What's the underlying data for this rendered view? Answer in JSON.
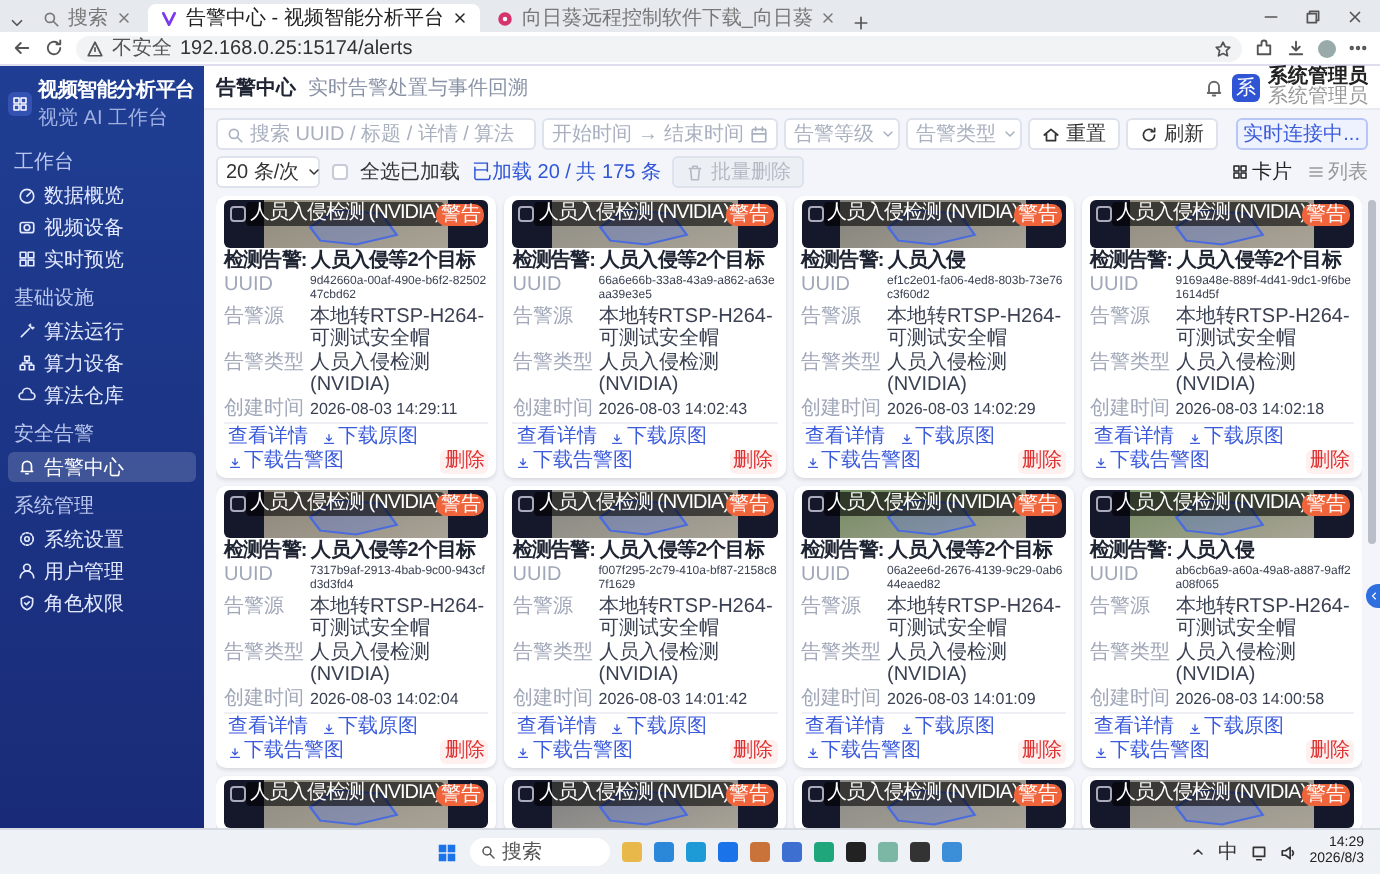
{
  "browser": {
    "tabs": [
      {
        "title": "搜索",
        "selected": false
      },
      {
        "title": "告警中心 - 视频智能分析平台",
        "selected": true
      },
      {
        "title": "向日葵远程控制软件下载_向日葵",
        "selected": false
      }
    ],
    "security": "不安全",
    "url": "192.168.0.25:15174/alerts"
  },
  "sidebar": {
    "brand": {
      "title": "视频智能分析平台",
      "subtitle": "视觉 AI 工作台"
    },
    "sections": [
      {
        "title": "工作台",
        "items": [
          {
            "label": "数据概览",
            "selected": false
          },
          {
            "label": "视频设备",
            "selected": false
          },
          {
            "label": "实时预览",
            "selected": false
          }
        ]
      },
      {
        "title": "基础设施",
        "items": [
          {
            "label": "算法运行",
            "selected": false
          },
          {
            "label": "算力设备",
            "selected": false
          },
          {
            "label": "算法仓库",
            "selected": false
          }
        ]
      },
      {
        "title": "安全告警",
        "items": [
          {
            "label": "告警中心",
            "selected": true
          }
        ]
      },
      {
        "title": "系统管理",
        "items": [
          {
            "label": "系统设置",
            "selected": false
          },
          {
            "label": "用户管理",
            "selected": false
          },
          {
            "label": "角色权限",
            "selected": false
          }
        ]
      }
    ]
  },
  "header": {
    "title": "告警中心",
    "subtitle": "实时告警处置与事件回溯",
    "user": {
      "avatar": "系",
      "name": "系统管理员",
      "role": "系统管理员"
    }
  },
  "filters": {
    "search": {
      "placeholder": "搜索 UUID / 标题 / 详情 / 算法"
    },
    "start": {
      "placeholder": "开始时间"
    },
    "arrow": "→",
    "end": {
      "placeholder": "结束时间"
    },
    "level": {
      "placeholder": "告警等级"
    },
    "type": {
      "placeholder": "告警类型"
    },
    "reset": "重置",
    "refresh": "刷新",
    "connection": "实时连接中..."
  },
  "toolbar": {
    "page_size": "20 条/次",
    "select_all": {
      "label": "全选已加载",
      "checked": false
    },
    "loaded": "已加载 20 / 共 175 条",
    "bulk_delete": {
      "label": "批量删除",
      "disabled": true
    },
    "views": [
      {
        "label": "卡片",
        "selected": true
      },
      {
        "label": "列表",
        "selected": false
      }
    ]
  },
  "alerts": [
    {
      "overlay": "人员入侵检测 (NVIDIA)",
      "badge": "警告",
      "checked": false,
      "title": "检测告警: 人员入侵等2个目标",
      "fields": [
        {
          "label": "UUID",
          "value": "9d42660a-00af-490e-b6f2-8250247cbd62",
          "kind": "id"
        },
        {
          "label": "告警源",
          "value": "本地转RTSP-H264-可测试安全帽",
          "kind": "text"
        },
        {
          "label": "告警类型",
          "value": "人员入侵检测 (NVIDIA)",
          "kind": "text"
        },
        {
          "label": "创建时间",
          "value": "2026-08-03 14:29:11",
          "kind": "time"
        }
      ],
      "actions": [
        {
          "label": "查看详情",
          "kind": "view"
        },
        {
          "label": "下载原图",
          "kind": "download"
        },
        {
          "label": "下载告警图",
          "kind": "download"
        },
        {
          "label": "删除",
          "kind": "delete"
        }
      ]
    },
    {
      "overlay": "人员入侵检测 (NVIDIA)",
      "badge": "警告",
      "checked": false,
      "title": "检测告警: 人员入侵等2个目标",
      "fields": [
        {
          "label": "UUID",
          "value": "66a6e66b-33a8-43a9-a862-a63eaa39e3e5",
          "kind": "id"
        },
        {
          "label": "告警源",
          "value": "本地转RTSP-H264-可测试安全帽",
          "kind": "text"
        },
        {
          "label": "告警类型",
          "value": "人员入侵检测 (NVIDIA)",
          "kind": "text"
        },
        {
          "label": "创建时间",
          "value": "2026-08-03 14:02:43",
          "kind": "time"
        }
      ],
      "actions": [
        {
          "label": "查看详情",
          "kind": "view"
        },
        {
          "label": "下载原图",
          "kind": "download"
        },
        {
          "label": "下载告警图",
          "kind": "download"
        },
        {
          "label": "删除",
          "kind": "delete"
        }
      ]
    },
    {
      "overlay": "人员入侵检测 (NVIDIA)",
      "badge": "警告",
      "checked": false,
      "title": "检测告警: 人员入侵",
      "fields": [
        {
          "label": "UUID",
          "value": "ef1c2e01-fa06-4ed8-803b-73e76c3f60d2",
          "kind": "id"
        },
        {
          "label": "告警源",
          "value": "本地转RTSP-H264-可测试安全帽",
          "kind": "text"
        },
        {
          "label": "告警类型",
          "value": "人员入侵检测 (NVIDIA)",
          "kind": "text"
        },
        {
          "label": "创建时间",
          "value": "2026-08-03 14:02:29",
          "kind": "time"
        }
      ],
      "actions": [
        {
          "label": "查看详情",
          "kind": "view"
        },
        {
          "label": "下载原图",
          "kind": "download"
        },
        {
          "label": "下载告警图",
          "kind": "download"
        },
        {
          "label": "删除",
          "kind": "delete"
        }
      ]
    },
    {
      "overlay": "人员入侵检测 (NVIDIA)",
      "badge": "警告",
      "checked": false,
      "title": "检测告警: 人员入侵等2个目标",
      "fields": [
        {
          "label": "UUID",
          "value": "9169a48e-889f-4d41-9dc1-9f6be1614d5f",
          "kind": "id"
        },
        {
          "label": "告警源",
          "value": "本地转RTSP-H264-可测试安全帽",
          "kind": "text"
        },
        {
          "label": "告警类型",
          "value": "人员入侵检测 (NVIDIA)",
          "kind": "text"
        },
        {
          "label": "创建时间",
          "value": "2026-08-03 14:02:18",
          "kind": "time"
        }
      ],
      "actions": [
        {
          "label": "查看详情",
          "kind": "view"
        },
        {
          "label": "下载原图",
          "kind": "download"
        },
        {
          "label": "下载告警图",
          "kind": "download"
        },
        {
          "label": "删除",
          "kind": "delete"
        }
      ]
    },
    {
      "overlay": "人员入侵检测 (NVIDIA)",
      "badge": "警告",
      "checked": false,
      "title": "检测告警: 人员入侵等2个目标",
      "fields": [
        {
          "label": "UUID",
          "value": "7317b9af-2913-4bab-9c00-943cfd3d3fd4",
          "kind": "id"
        },
        {
          "label": "告警源",
          "value": "本地转RTSP-H264-可测试安全帽",
          "kind": "text"
        },
        {
          "label": "告警类型",
          "value": "人员入侵检测 (NVIDIA)",
          "kind": "text"
        },
        {
          "label": "创建时间",
          "value": "2026-08-03 14:02:04",
          "kind": "time"
        }
      ],
      "actions": [
        {
          "label": "查看详情",
          "kind": "view"
        },
        {
          "label": "下载原图",
          "kind": "download"
        },
        {
          "label": "下载告警图",
          "kind": "download"
        },
        {
          "label": "删除",
          "kind": "delete"
        }
      ]
    },
    {
      "overlay": "人员入侵检测 (NVIDIA)",
      "badge": "警告",
      "checked": false,
      "title": "检测告警: 人员入侵等2个目标",
      "fields": [
        {
          "label": "UUID",
          "value": "f007f295-2c79-410a-bf87-2158c87f1629",
          "kind": "id"
        },
        {
          "label": "告警源",
          "value": "本地转RTSP-H264-可测试安全帽",
          "kind": "text"
        },
        {
          "label": "告警类型",
          "value": "人员入侵检测 (NVIDIA)",
          "kind": "text"
        },
        {
          "label": "创建时间",
          "value": "2026-08-03 14:01:42",
          "kind": "time"
        }
      ],
      "actions": [
        {
          "label": "查看详情",
          "kind": "view"
        },
        {
          "label": "下载原图",
          "kind": "download"
        },
        {
          "label": "下载告警图",
          "kind": "download"
        },
        {
          "label": "删除",
          "kind": "delete"
        }
      ]
    },
    {
      "overlay": "人员入侵检测 (NVIDIA)",
      "badge": "警告",
      "checked": false,
      "title": "检测告警: 人员入侵等2个目标",
      "fields": [
        {
          "label": "UUID",
          "value": "06a2ee6d-2676-4139-9c29-0ab644eaed82",
          "kind": "id"
        },
        {
          "label": "告警源",
          "value": "本地转RTSP-H264-可测试安全帽",
          "kind": "text"
        },
        {
          "label": "告警类型",
          "value": "人员入侵检测 (NVIDIA)",
          "kind": "text"
        },
        {
          "label": "创建时间",
          "value": "2026-08-03 14:01:09",
          "kind": "time"
        }
      ],
      "actions": [
        {
          "label": "查看详情",
          "kind": "view"
        },
        {
          "label": "下载原图",
          "kind": "download"
        },
        {
          "label": "下载告警图",
          "kind": "download"
        },
        {
          "label": "删除",
          "kind": "delete"
        }
      ]
    },
    {
      "overlay": "人员入侵检测 (NVIDIA)",
      "badge": "警告",
      "checked": false,
      "title": "检测告警: 人员入侵",
      "fields": [
        {
          "label": "UUID",
          "value": "ab6cb6a9-a60a-49a8-a887-9aff2a08f065",
          "kind": "id"
        },
        {
          "label": "告警源",
          "value": "本地转RTSP-H264-可测试安全帽",
          "kind": "text"
        },
        {
          "label": "告警类型",
          "value": "人员入侵检测 (NVIDIA)",
          "kind": "text"
        },
        {
          "label": "创建时间",
          "value": "2026-08-03 14:00:58",
          "kind": "time"
        }
      ],
      "actions": [
        {
          "label": "查看详情",
          "kind": "view"
        },
        {
          "label": "下载原图",
          "kind": "download"
        },
        {
          "label": "下载告警图",
          "kind": "download"
        },
        {
          "label": "删除",
          "kind": "delete"
        }
      ]
    },
    {
      "overlay": "人员入侵检测 (NVIDIA)",
      "badge": "警告",
      "checked": false
    },
    {
      "overlay": "人员入侵检测 (NVIDIA)",
      "badge": "警告",
      "checked": false
    },
    {
      "overlay": "人员入侵检测 (NVIDIA)",
      "badge": "警告",
      "checked": false
    },
    {
      "overlay": "人员入侵检测 (NVIDIA)",
      "badge": "警告",
      "checked": false
    }
  ],
  "taskbar": {
    "search": {
      "placeholder": "搜索"
    },
    "ime": "中",
    "time": "14:29",
    "date": "2026/8/3"
  }
}
